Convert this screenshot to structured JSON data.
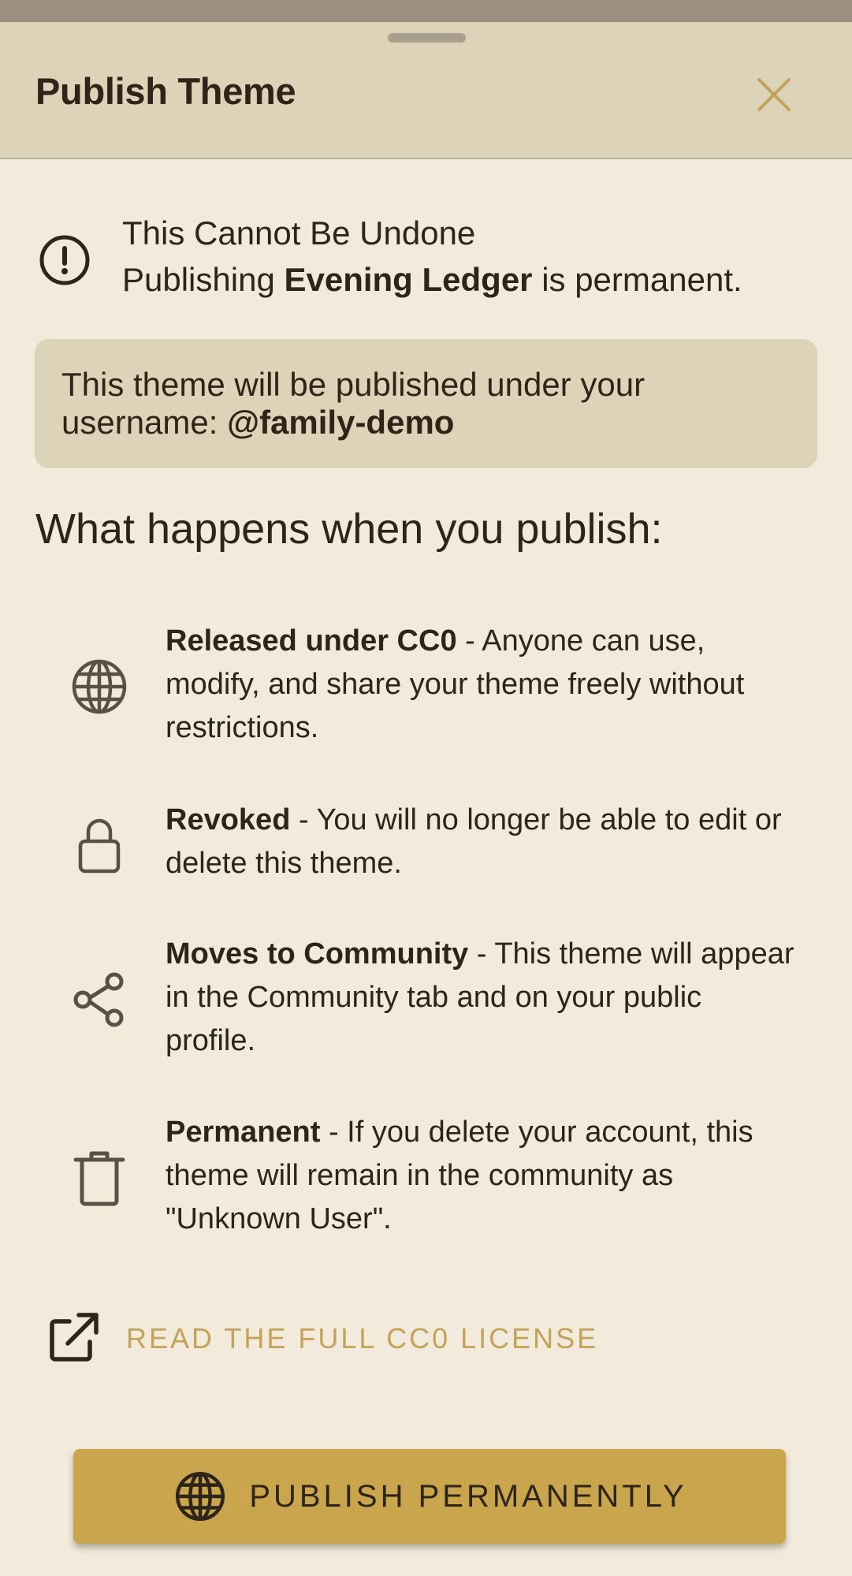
{
  "sheet": {
    "title": "Publish Theme",
    "close_icon": "close-icon"
  },
  "warning": {
    "icon": "alert-circle-icon",
    "title": "This Cannot Be Undone",
    "sub_prefix": "Publishing ",
    "theme_name": "Evening Ledger",
    "sub_suffix": " is permanent."
  },
  "notice": {
    "text": "This theme will be published under your username: ",
    "username": "@family-demo"
  },
  "section": {
    "title": "What happens when you publish:"
  },
  "items": [
    {
      "icon": "globe-icon",
      "title": "Released under CC0",
      "desc": " - Anyone can use, modify, and share your theme freely without restrictions."
    },
    {
      "icon": "lock-icon",
      "title": "Revoked",
      "desc": " - You will no longer be able to edit or delete this theme."
    },
    {
      "icon": "share-icon",
      "title": "Moves to Community",
      "desc": " - This theme will appear in the Community tab and on your public profile."
    },
    {
      "icon": "trash-icon",
      "title": "Permanent",
      "desc": " - If you delete your account, this theme will remain in the community as \"Unknown User\"."
    }
  ],
  "license_link": {
    "icon": "external-link-icon",
    "label": "READ THE FULL CC0 LICENSE"
  },
  "publish_button": {
    "icon": "globe-icon",
    "label": "PUBLISH PERMANENTLY"
  },
  "colors": {
    "sheet_background": "#f2eadb",
    "header_background": "#ddd3b8",
    "accent": "#c9a54e",
    "link": "#c4a25a",
    "text": "#2e2418",
    "icon": "#5a5046"
  }
}
